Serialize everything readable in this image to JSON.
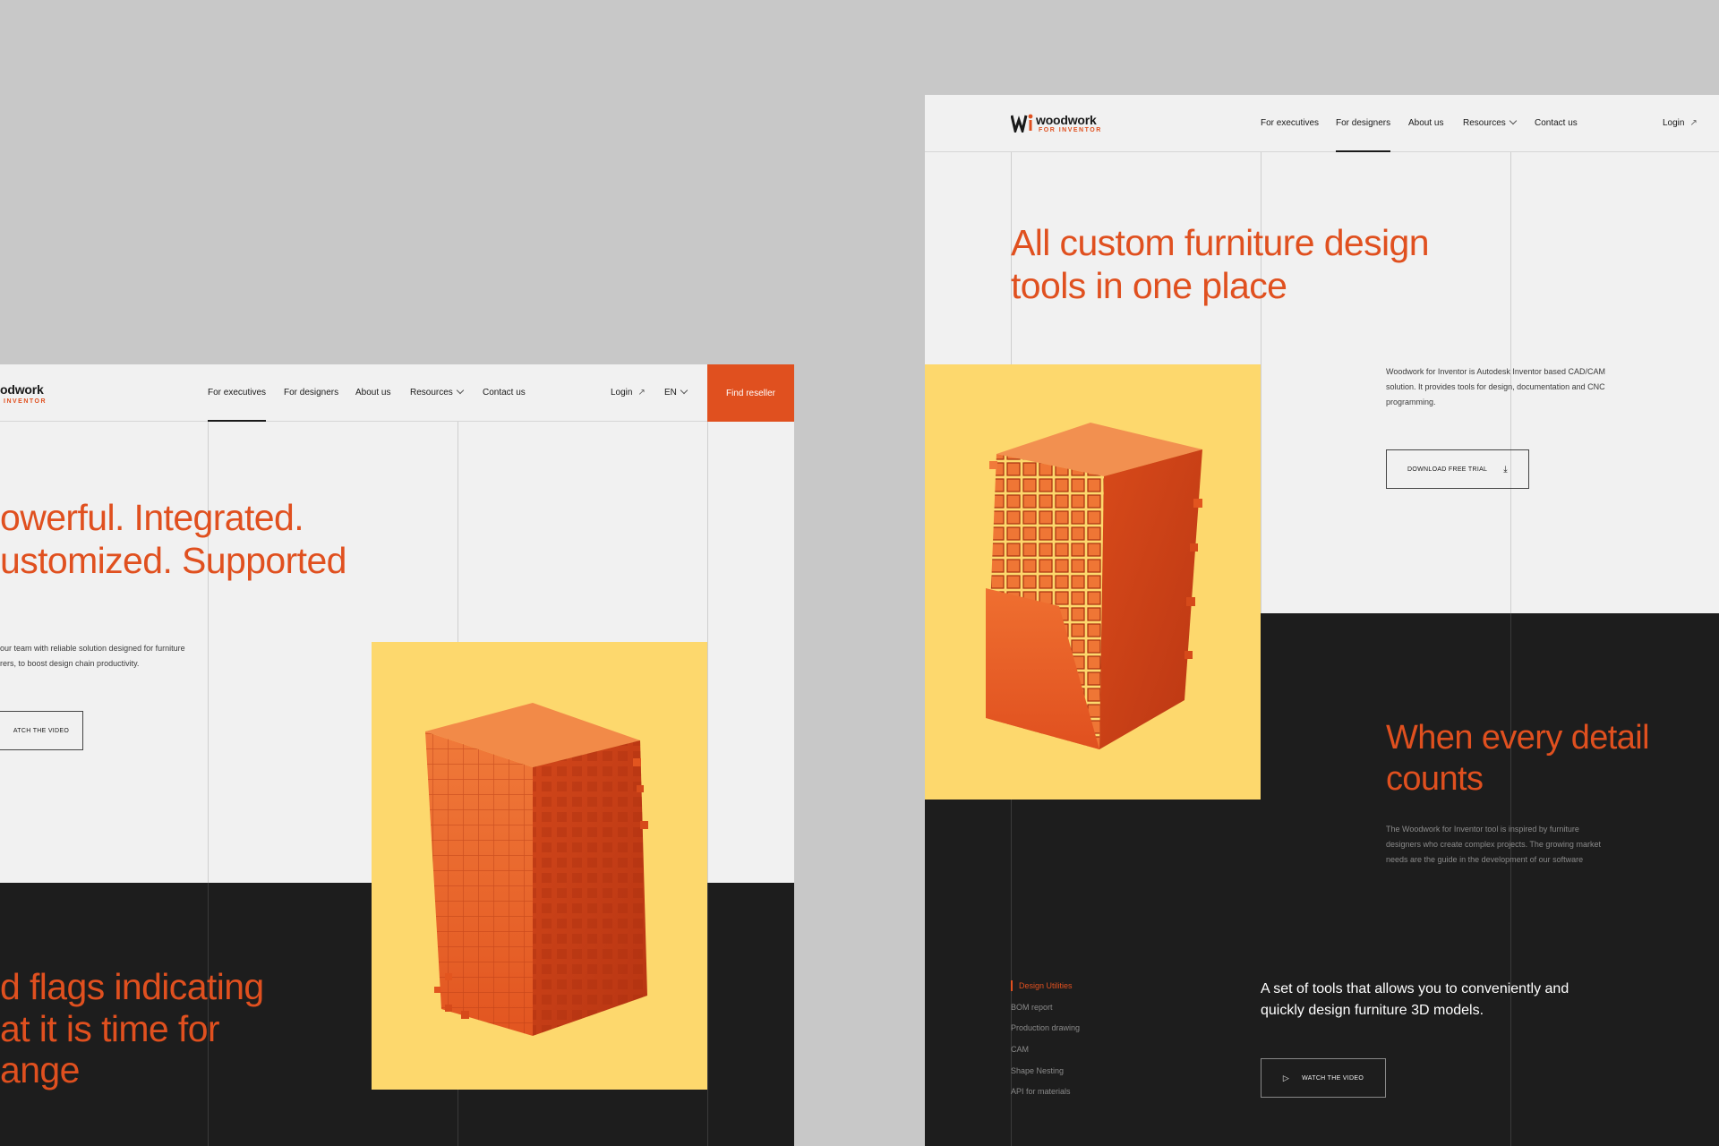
{
  "colors": {
    "accent": "#e0501f",
    "background": "#c8c8c8",
    "panel": "#f1f1f1",
    "dark": "#1d1d1d",
    "yellow": "#fdd86d"
  },
  "left": {
    "logo": {
      "word": "odwork",
      "sub": "INVENTOR"
    },
    "nav": {
      "items": [
        "For executives",
        "For designers",
        "About us",
        "Resources",
        "Contact us"
      ],
      "login": "Login",
      "lang": "EN",
      "cta": "Find reseller"
    },
    "hero": {
      "line1": "owerful. Integrated.",
      "line2": "ustomized. Supported",
      "body1": "our team with reliable solution designed for furniture",
      "body2": "rers, to boost design chain productivity.",
      "button": "ATCH THE VIDEO"
    },
    "section2": {
      "line1": "d flags indicating",
      "line2": "at it is time for",
      "line3": "ange"
    }
  },
  "right": {
    "logo": {
      "word": "woodwork",
      "sub": "FOR INVENTOR"
    },
    "nav": {
      "items": [
        "For executives",
        "For designers",
        "About us",
        "Resources",
        "Contact us"
      ],
      "login": "Login"
    },
    "hero": {
      "line1": "All custom furniture design",
      "line2": "tools in one place",
      "body1": "Woodwork for Inventor is Autodesk Inventor based CAD/CAM",
      "body2": "solution. It provides tools for design, documentation and CNC",
      "body3": "programming.",
      "button": "DOWNLOAD FREE TRIAL"
    },
    "detail": {
      "line1": "When every detail",
      "line2": "counts",
      "body1": "The Woodwork for Inventor tool is inspired by furniture",
      "body2": "designers who create complex projects. The growing market",
      "body3": "needs are the guide in the development of our software"
    },
    "tools": {
      "items": [
        "Design Utilities",
        "BOM report",
        "Production drawing",
        "CAM",
        "Shape Nesting",
        "API for materials"
      ],
      "description1": "A set of tools that allows you to conveniently and",
      "description2": "quickly design furniture 3D models.",
      "button": "WATCH THE VIDEO"
    }
  }
}
